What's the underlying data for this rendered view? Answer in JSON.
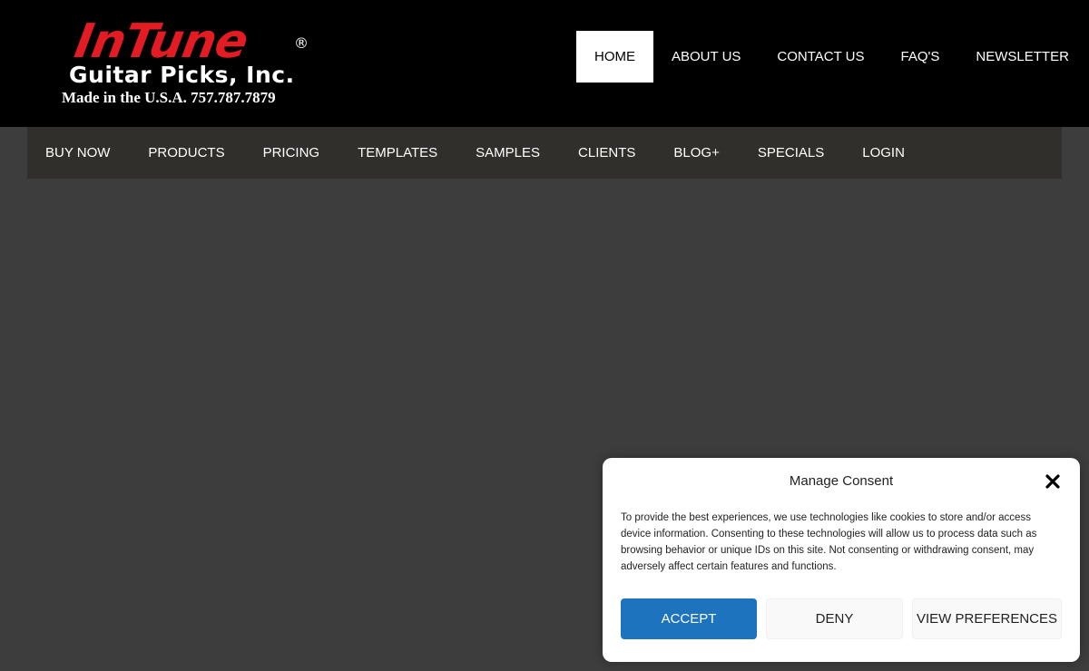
{
  "logo": {
    "brand": "InTune",
    "registered": "®",
    "company": "Guitar Picks, Inc.",
    "tagline": "Made in the U.S.A. 757.787.7879",
    "colors": {
      "brand_red": "#e31b23"
    }
  },
  "top_nav": {
    "items": [
      {
        "label": "HOME",
        "active": true
      },
      {
        "label": "ABOUT US",
        "active": false
      },
      {
        "label": "CONTACT US",
        "active": false
      },
      {
        "label": "FAQ'S",
        "active": false
      },
      {
        "label": "NEWSLETTER",
        "active": false
      }
    ]
  },
  "secondary_nav": {
    "items": [
      {
        "label": "BUY NOW"
      },
      {
        "label": "PRODUCTS"
      },
      {
        "label": "PRICING"
      },
      {
        "label": "TEMPLATES"
      },
      {
        "label": "SAMPLES"
      },
      {
        "label": "CLIENTS"
      },
      {
        "label": "BLOG+"
      },
      {
        "label": "SPECIALS"
      },
      {
        "label": "LOGIN"
      }
    ]
  },
  "consent": {
    "title": "Manage Consent",
    "close_icon": "close-icon",
    "body": "To provide the best experiences, we use technologies like cookies to store and/or access device information. Consenting to these technologies will allow us to process data such as browsing behavior or unique IDs on this site. Not consenting or withdrawing consent, may adversely affect certain features and functions.",
    "accept_label": "ACCEPT",
    "deny_label": "DENY",
    "preferences_label": "VIEW PREFERENCES",
    "colors": {
      "accept_bg": "#1e73be"
    }
  }
}
